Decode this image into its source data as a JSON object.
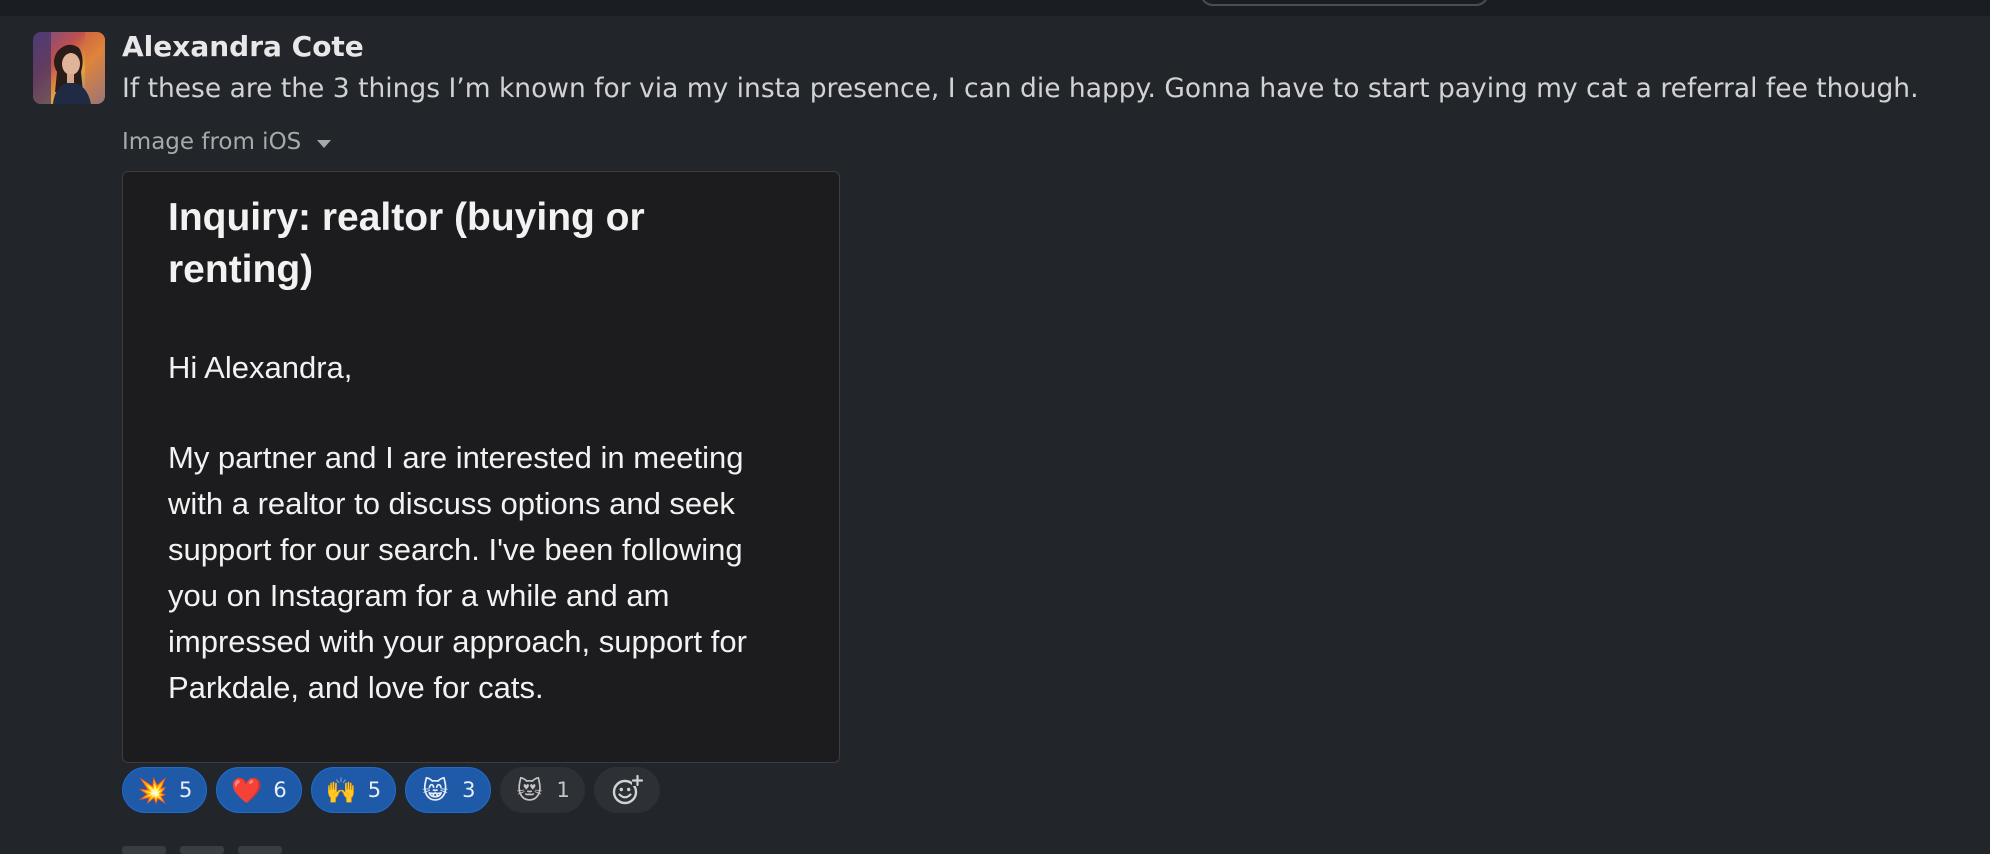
{
  "message": {
    "sender": "Alexandra Cote",
    "text": "If these are the 3 things I’m known for via my insta presence, I can die happy. Gonna have to start paying my cat a referral fee though."
  },
  "attachment": {
    "label": "Image from iOS",
    "title": "Inquiry: realtor (buying or renting)",
    "greeting": "Hi Alexandra,",
    "body_lines": [
      "My partner and I are interested in meeting",
      "with a realtor to discuss options and seek",
      "support for our search. I've been following",
      "you on Instagram for a while and am",
      "impressed with your approach, support for",
      "Parkdale, and love for cats."
    ]
  },
  "reactions": [
    {
      "emoji": "💥",
      "icon": "collision-emoji",
      "count": "5",
      "active": true
    },
    {
      "emoji": "❤️",
      "icon": "heart-emoji",
      "count": "6",
      "active": true
    },
    {
      "emoji": "🙌",
      "icon": "raised-hands-emoji",
      "count": "5",
      "active": true
    },
    {
      "emoji": "😸",
      "icon": "grinning-cat-emoji",
      "count": "3",
      "active": true
    },
    {
      "emoji": "😻",
      "icon": "heart-eyes-cat-emoji",
      "count": "1",
      "active": false
    }
  ],
  "colors": {
    "background": "#222529",
    "reaction_active": "#1e5aa8",
    "reaction_inactive": "#2d3035"
  }
}
